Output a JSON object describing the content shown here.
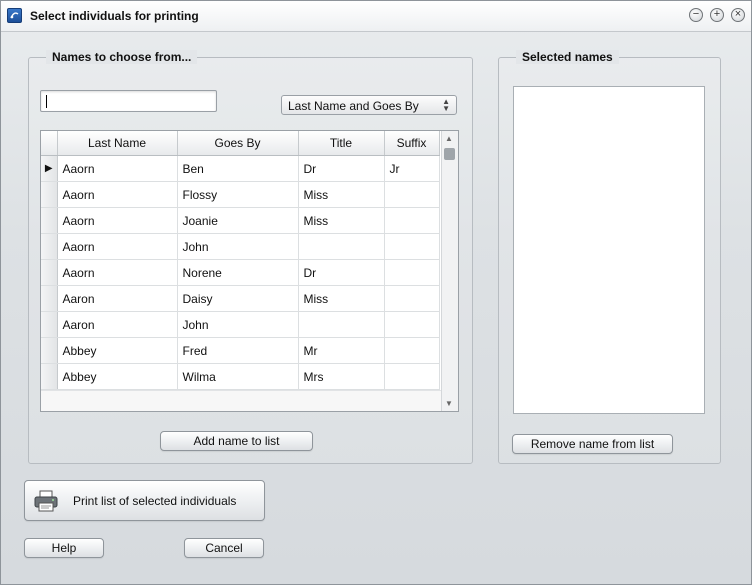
{
  "window": {
    "title": "Select individuals for printing",
    "controls": {
      "minimize": "−",
      "maximize": "+",
      "close": "×"
    }
  },
  "choose_group": {
    "title": "Names to choose from...",
    "search_value": "",
    "sort_selected": "Last Name and Goes By",
    "columns": [
      "Last Name",
      "Goes By",
      "Title",
      "Suffix"
    ],
    "current_row_marker": "▶",
    "rows": [
      {
        "last": "Aaorn",
        "goes_by": "Ben",
        "title": "Dr",
        "suffix": "Jr"
      },
      {
        "last": "Aaorn",
        "goes_by": "Flossy",
        "title": "Miss",
        "suffix": ""
      },
      {
        "last": "Aaorn",
        "goes_by": "Joanie",
        "title": "Miss",
        "suffix": ""
      },
      {
        "last": "Aaorn",
        "goes_by": "John",
        "title": "",
        "suffix": ""
      },
      {
        "last": "Aaorn",
        "goes_by": "Norene",
        "title": "Dr",
        "suffix": ""
      },
      {
        "last": "Aaron",
        "goes_by": "Daisy",
        "title": "Miss",
        "suffix": ""
      },
      {
        "last": "Aaron",
        "goes_by": "John",
        "title": "",
        "suffix": ""
      },
      {
        "last": "Abbey",
        "goes_by": "Fred",
        "title": "Mr",
        "suffix": ""
      },
      {
        "last": "Abbey",
        "goes_by": "Wilma",
        "title": "Mrs",
        "suffix": ""
      }
    ],
    "add_button": "Add name to list"
  },
  "selected_group": {
    "title": "Selected names",
    "remove_button": "Remove name from list"
  },
  "print_button": "Print list of selected individuals",
  "help_button": "Help",
  "cancel_button": "Cancel"
}
